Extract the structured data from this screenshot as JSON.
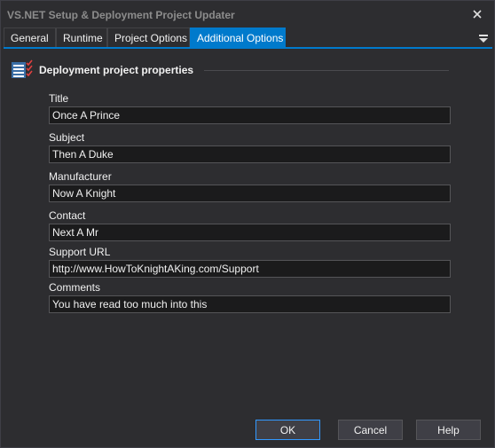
{
  "window": {
    "title": "VS.NET Setup & Deployment Project Updater"
  },
  "tabs": [
    {
      "label": "General"
    },
    {
      "label": "Runtime"
    },
    {
      "label": "Project Options"
    },
    {
      "label": "Additional Options",
      "active": true
    }
  ],
  "section": {
    "title": "Deployment project properties"
  },
  "fields": {
    "title": {
      "label": "Title",
      "value": "Once A Prince"
    },
    "subject": {
      "label": "Subject",
      "value": "Then A Duke"
    },
    "manufacturer": {
      "label": "Manufacturer",
      "value": "Now A Knight"
    },
    "contact": {
      "label": "Contact",
      "value": "Next A Mr"
    },
    "support_url": {
      "label": "Support URL",
      "value": "http://www.HowToKnightAKing.com/Support"
    },
    "comments": {
      "label": "Comments",
      "value": "You have read too much into this"
    }
  },
  "buttons": {
    "ok": "OK",
    "cancel": "Cancel",
    "help": "Help"
  },
  "colors": {
    "accent": "#007acc",
    "background": "#2d2d30",
    "field_background": "#1b1b1c"
  }
}
